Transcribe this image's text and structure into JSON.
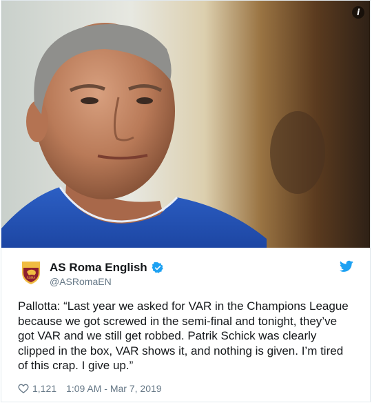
{
  "tweet": {
    "author_name": "AS Roma English",
    "handle": "@ASRomaEN",
    "text": "Pallotta: “Last year we asked for VAR in the Champions League because we got screwed in the semi-final and tonight, they’ve got VAR and we still get robbed. Patrik Schick was clearly clipped in the box, VAR shows it, and nothing is given. I’m tired of this crap. I give up.”",
    "likes": "1,121",
    "timestamp": "1:09 AM - Mar 7, 2019"
  },
  "icons": {
    "info": "info-icon",
    "verified": "verified-badge-icon",
    "bird": "twitter-bird-icon",
    "heart": "heart-icon",
    "avatar": "as-roma-crest"
  },
  "colors": {
    "twitter_blue": "#1da1f2",
    "text": "#14171a",
    "muted": "#657786",
    "roma_red": "#8e1f2f",
    "roma_gold": "#f0bc42"
  }
}
